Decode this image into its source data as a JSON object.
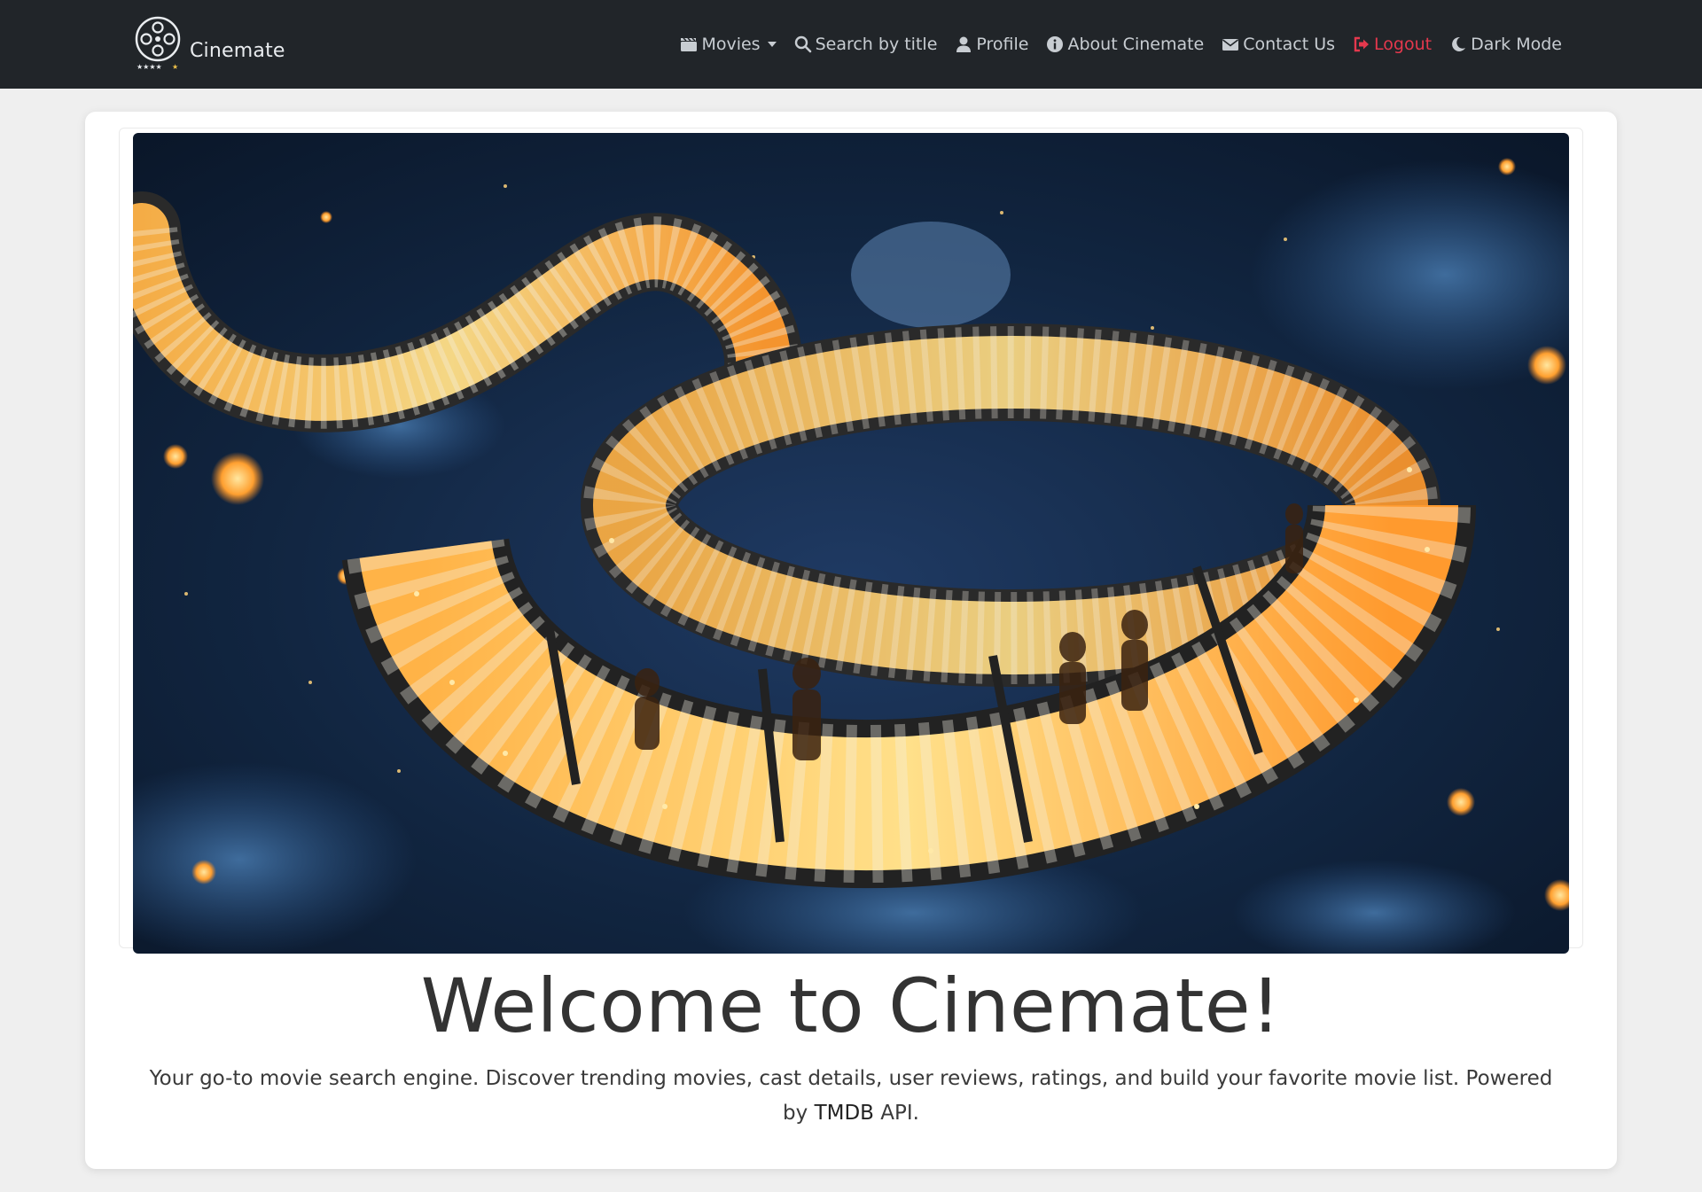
{
  "brand": {
    "name": "Cinemate",
    "logo_icon": "film-reel-icon"
  },
  "nav": {
    "movies": {
      "label": "Movies",
      "icon": "clapperboard-icon"
    },
    "search": {
      "label": "Search by title",
      "icon": "search-icon"
    },
    "profile": {
      "label": "Profile",
      "icon": "user-icon"
    },
    "about": {
      "label": "About Cinemate",
      "icon": "info-icon"
    },
    "contact": {
      "label": "Contact Us",
      "icon": "envelope-icon"
    },
    "logout": {
      "label": "Logout",
      "icon": "sign-out-icon",
      "color": "#e4384d"
    },
    "darkmode": {
      "label": "Dark Mode",
      "icon": "moon-icon"
    }
  },
  "hero": {
    "image": "glowing-film-reel-illustration"
  },
  "main": {
    "title": "Welcome to Cinemate!",
    "tagline_prefix": "Your go-to movie search engine. Discover trending movies, cast details, user reviews, ratings, and build your favorite movie list. Powered by",
    "tagline_tmdb": "TMDB",
    "tagline_suffix": "API."
  },
  "colors": {
    "navbar": "#212529",
    "background": "#efefef",
    "accent_logout": "#e4384d"
  }
}
